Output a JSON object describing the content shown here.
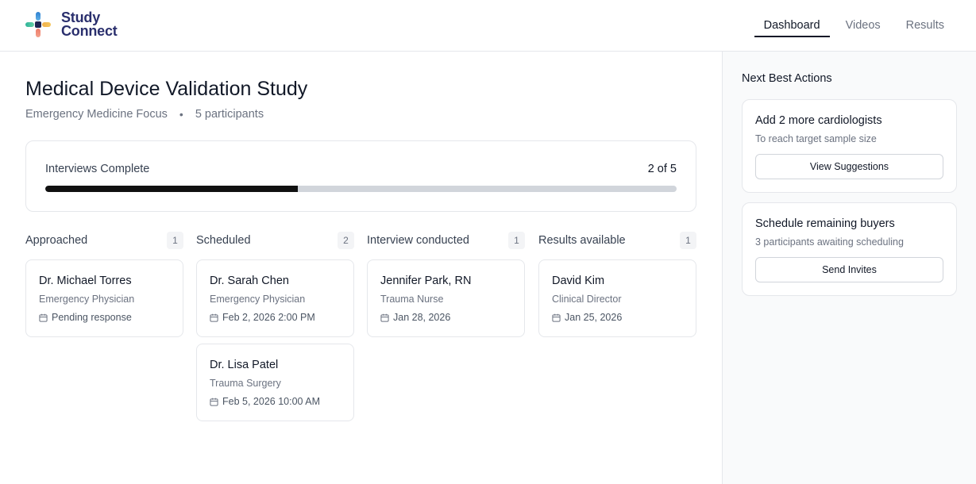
{
  "app": {
    "logo_line1": "Study",
    "logo_line2": "Connect"
  },
  "nav": {
    "items": [
      {
        "label": "Dashboard",
        "active": true
      },
      {
        "label": "Videos",
        "active": false
      },
      {
        "label": "Results",
        "active": false
      }
    ]
  },
  "study": {
    "title": "Medical Device Validation Study",
    "focus": "Emergency Medicine Focus",
    "separator": "•",
    "participants": "5 participants"
  },
  "progress": {
    "label": "Interviews Complete",
    "count_text": "2 of 5",
    "fraction": 0.4
  },
  "columns": [
    {
      "title": "Approached",
      "count": "1",
      "cards": [
        {
          "name": "Dr. Michael Torres",
          "role": "Emergency Physician",
          "meta": "Pending response"
        }
      ]
    },
    {
      "title": "Scheduled",
      "count": "2",
      "cards": [
        {
          "name": "Dr. Sarah Chen",
          "role": "Emergency Physician",
          "meta": "Feb 2, 2026 2:00 PM"
        },
        {
          "name": "Dr. Lisa Patel",
          "role": "Trauma Surgery",
          "meta": "Feb 5, 2026 10:00 AM"
        }
      ]
    },
    {
      "title": "Interview conducted",
      "count": "1",
      "cards": [
        {
          "name": "Jennifer Park, RN",
          "role": "Trauma Nurse",
          "meta": "Jan 28, 2026"
        }
      ]
    },
    {
      "title": "Results available",
      "count": "1",
      "cards": [
        {
          "name": "David Kim",
          "role": "Clinical Director",
          "meta": "Jan 25, 2026"
        }
      ]
    }
  ],
  "sidebar": {
    "title": "Next Best Actions",
    "actions": [
      {
        "title": "Add 2 more cardiologists",
        "desc": "To reach target sample size",
        "button": "View Suggestions"
      },
      {
        "title": "Schedule remaining buyers",
        "desc": "3 participants awaiting scheduling",
        "button": "Send Invites"
      }
    ]
  },
  "icons": {
    "logo": "cross-logo-icon",
    "card_meta": "calendar-icon"
  },
  "colors": {
    "brand_text": "#2a2f6d",
    "progress_fill": "#111111",
    "progress_track": "#d1d5db"
  }
}
